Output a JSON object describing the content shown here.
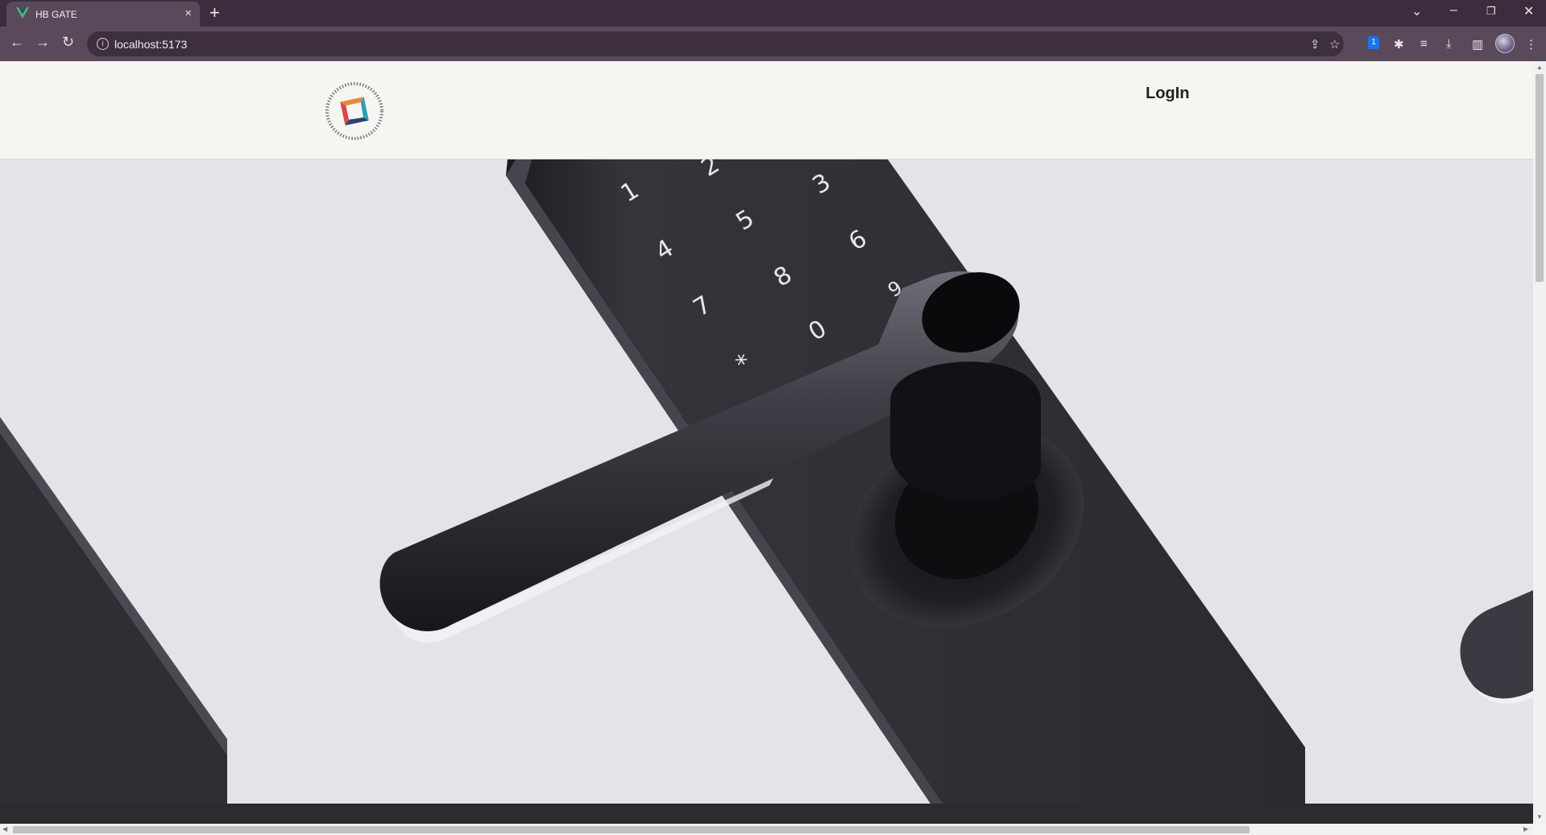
{
  "browser": {
    "tab_title": "HB GATE",
    "tab_close": "×",
    "new_tab": "+",
    "url": "localhost:5173",
    "info_glyph": "i",
    "extension_badge": "1",
    "window": {
      "chevron": "⌄",
      "minimize": "–",
      "restore": "❐",
      "close": "✕"
    },
    "nav": {
      "back": "←",
      "forward": "→",
      "reload": "↻"
    },
    "icons": {
      "share": "⇪",
      "star": "☆",
      "puzzle": "✱",
      "media": "≡",
      "download": "⤓",
      "sidepanel": "▥",
      "menu": "⋮"
    }
  },
  "header": {
    "login_label": "LogIn"
  },
  "hero": {
    "keypad_digits": [
      "1",
      "2",
      "3",
      "4",
      "5",
      "6",
      "7",
      "8",
      "9",
      "0",
      "*",
      "#"
    ]
  },
  "scroll": {
    "up": "▲",
    "down": "▼",
    "left": "◀",
    "right": "▶"
  },
  "colors": {
    "tabbar": "#3d2c3e",
    "toolbar": "#5a485b",
    "page_bg": "#f6f5f1",
    "hero_bg": "#e4e3e7",
    "lock_body": "#2d2d33",
    "footer_band": "#2c2b2e",
    "logo_orange": "#e8893f",
    "logo_teal": "#2b9fb7",
    "logo_red": "#d8484a",
    "logo_navy": "#2b3f7a"
  }
}
